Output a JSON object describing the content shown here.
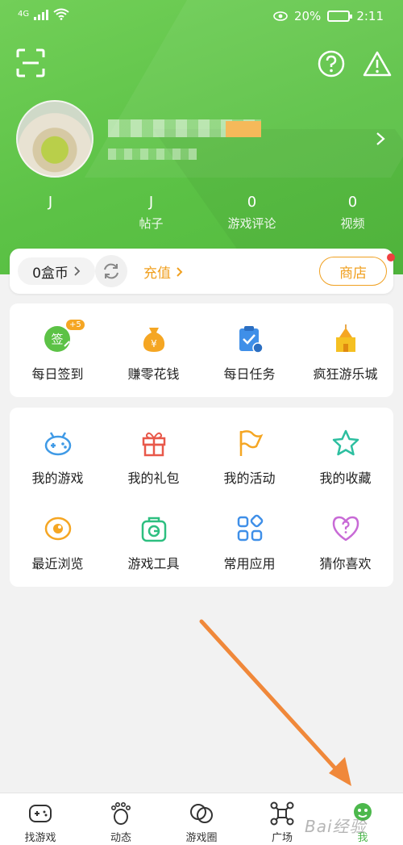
{
  "status_bar": {
    "network": "4G",
    "battery_percent": "20%",
    "time": "2:11"
  },
  "profile": {
    "stats": [
      {
        "value": "J",
        "label": ""
      },
      {
        "value": "J",
        "label": "帖子"
      },
      {
        "value": "0",
        "label": "游戏评论"
      },
      {
        "value": "0",
        "label": "视频"
      }
    ]
  },
  "coin_bar": {
    "coins": "0盒币",
    "recharge": "充值",
    "shop": "商店"
  },
  "daily": [
    {
      "label": "每日签到",
      "icon": "sign-in-icon",
      "badge": "+5",
      "color": "#5cc246"
    },
    {
      "label": "赚零花钱",
      "icon": "money-bag-icon",
      "color": "#f5a623"
    },
    {
      "label": "每日任务",
      "icon": "task-clipboard-icon",
      "color": "#3f8fe8"
    },
    {
      "label": "疯狂游乐城",
      "icon": "castle-icon",
      "color": "#f5c022"
    }
  ],
  "features": [
    {
      "label": "我的游戏",
      "icon": "gamepad-icon",
      "color": "#3f9ae6"
    },
    {
      "label": "我的礼包",
      "icon": "gift-icon",
      "color": "#e8584a"
    },
    {
      "label": "我的活动",
      "icon": "flag-icon",
      "color": "#f5a623"
    },
    {
      "label": "我的收藏",
      "icon": "star-icon",
      "color": "#2dbfa0"
    },
    {
      "label": "最近浏览",
      "icon": "eye-icon",
      "color": "#f5a623"
    },
    {
      "label": "游戏工具",
      "icon": "toolbox-icon",
      "color": "#2dbf80"
    },
    {
      "label": "常用应用",
      "icon": "apps-grid-icon",
      "color": "#3f8fe8"
    },
    {
      "label": "猜你喜欢",
      "icon": "heart-question-icon",
      "color": "#c86ad6"
    }
  ],
  "bottom_nav": [
    {
      "label": "找游戏",
      "icon": "gamepad-nav-icon"
    },
    {
      "label": "动态",
      "icon": "footprint-icon"
    },
    {
      "label": "游戏圈",
      "icon": "circles-icon"
    },
    {
      "label": "广场",
      "icon": "hub-icon"
    },
    {
      "label": "我",
      "icon": "mascot-icon",
      "active": true
    }
  ],
  "watermark": "Bai经验",
  "colors": {
    "header_green": "#5cc246",
    "accent_orange": "#f0a020",
    "annotation_arrow": "#f0883a"
  }
}
